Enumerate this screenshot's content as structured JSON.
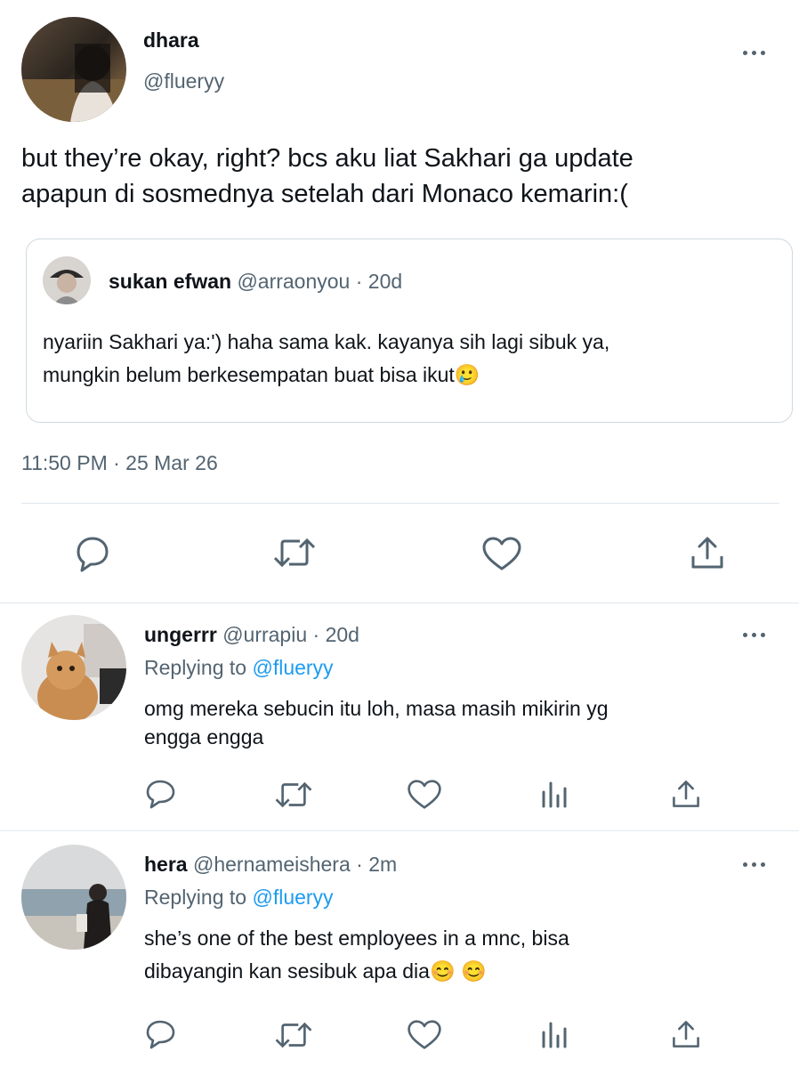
{
  "main_tweet": {
    "author_name": "dhara",
    "author_handle": "@flueryy",
    "text_line1": "but they’re okay, right? bcs aku liat Sakhari ga update",
    "text_line2": "apapun di sosmednya setelah dari Monaco kemarin:(",
    "timestamp": "11:50 PM · 25 Mar 26",
    "quoted": {
      "author_name": "sukan efwan",
      "author_handle": "@arraonyou",
      "time": "· 20d",
      "text_line1": "nyariin Sakhari ya:') haha sama kak. kayanya sih lagi sibuk ya,",
      "text_line2": "mungkin belum berkesempatan buat bisa ikut",
      "emoji": "🥲"
    }
  },
  "replies": [
    {
      "author_name": "ungerrr",
      "author_handle": "@urrapiu",
      "time": "· 20d",
      "replying_label": "Replying to",
      "replying_handle": "@flueryy",
      "text_line1": "omg mereka sebucin itu loh, masa masih mikirin yg",
      "text_line2": "engga engga",
      "emoji": ""
    },
    {
      "author_name": "hera",
      "author_handle": "@hernameishera",
      "time": "· 2m",
      "replying_label": "Replying to",
      "replying_handle": "@flueryy",
      "text_line1": "she’s one of the best employees in a mnc, bisa",
      "text_line2": "dibayangin kan sesibuk apa dia",
      "emoji": "😊 😊"
    }
  ],
  "icons": {
    "reply": "speech-bubble",
    "retweet": "retweet-arrows",
    "like": "heart",
    "views": "bar-chart",
    "share": "share-upload",
    "more": "three-dots"
  },
  "colors": {
    "text": "#0f1419",
    "secondary": "#536471",
    "link": "#1d9bf0",
    "divider": "#e1e8ed"
  }
}
